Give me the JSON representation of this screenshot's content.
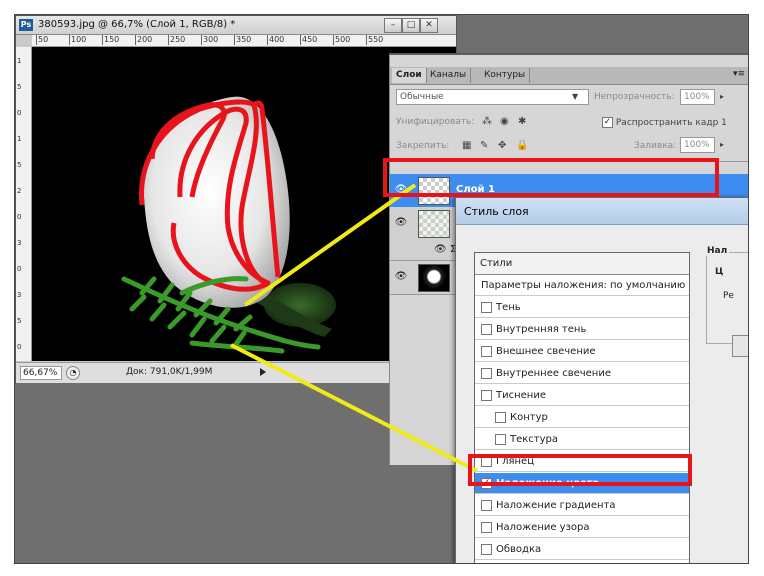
{
  "document": {
    "ps_badge": "Ps",
    "title": "380593.jpg @ 66,7% (Слой 1, RGB/8) *",
    "ruler_h": [
      "50",
      "100",
      "150",
      "200",
      "250",
      "300",
      "350",
      "400",
      "450",
      "500",
      "550"
    ],
    "ruler_v": [
      "1",
      "5",
      "0",
      "1",
      "5",
      "2",
      "0",
      "3",
      "0",
      "3",
      "5",
      "0"
    ],
    "zoom": "66,67%",
    "doc_info": "Док: 791,0K/1,99M"
  },
  "layers_panel": {
    "tabs": [
      "Слои",
      "Каналы",
      "Контуры"
    ],
    "blend_mode": "Обычные",
    "opacity_label": "Непрозрачность:",
    "opacity_value": "100%",
    "unify_label": "Унифицировать:",
    "propagate_label": "Распространить кадр 1",
    "lock_label": "Закрепить:",
    "fill_label": "Заливка:",
    "fill_value": "100%",
    "layers": [
      {
        "name": "Слой 1",
        "selected": true
      },
      {
        "name": "",
        "selected": false
      },
      {
        "name": "",
        "selected": false
      }
    ]
  },
  "layer_style_dialog": {
    "title": "Стиль слоя",
    "list_header": "Стили",
    "items": [
      {
        "label": "Параметры наложения: по умолчанию",
        "checkbox": false,
        "checked": false,
        "sub": false,
        "selected": false
      },
      {
        "label": "Тень",
        "checkbox": true,
        "checked": false,
        "sub": false,
        "selected": false
      },
      {
        "label": "Внутренняя тень",
        "checkbox": true,
        "checked": false,
        "sub": false,
        "selected": false
      },
      {
        "label": "Внешнее свечение",
        "checkbox": true,
        "checked": false,
        "sub": false,
        "selected": false
      },
      {
        "label": "Внутреннее свечение",
        "checkbox": true,
        "checked": false,
        "sub": false,
        "selected": false
      },
      {
        "label": "Тиснение",
        "checkbox": true,
        "checked": false,
        "sub": false,
        "selected": false
      },
      {
        "label": "Контур",
        "checkbox": true,
        "checked": false,
        "sub": true,
        "selected": false
      },
      {
        "label": "Текстура",
        "checkbox": true,
        "checked": false,
        "sub": true,
        "selected": false
      },
      {
        "label": "Глянец",
        "checkbox": true,
        "checked": false,
        "sub": false,
        "selected": false
      },
      {
        "label": "Наложение цвета",
        "checkbox": true,
        "checked": true,
        "sub": false,
        "selected": true
      },
      {
        "label": "Наложение градиента",
        "checkbox": true,
        "checked": false,
        "sub": false,
        "selected": false
      },
      {
        "label": "Наложение узора",
        "checkbox": true,
        "checked": false,
        "sub": false,
        "selected": false
      },
      {
        "label": "Обводка",
        "checkbox": true,
        "checked": false,
        "sub": false,
        "selected": false
      }
    ],
    "right_header": "Нал",
    "right_sub": "Ц",
    "right_text": "Ре"
  },
  "colors": {
    "selection_blue": "#3d8cf0",
    "annotation_red": "#e8141c",
    "annotation_yellow": "#f2ea16"
  }
}
